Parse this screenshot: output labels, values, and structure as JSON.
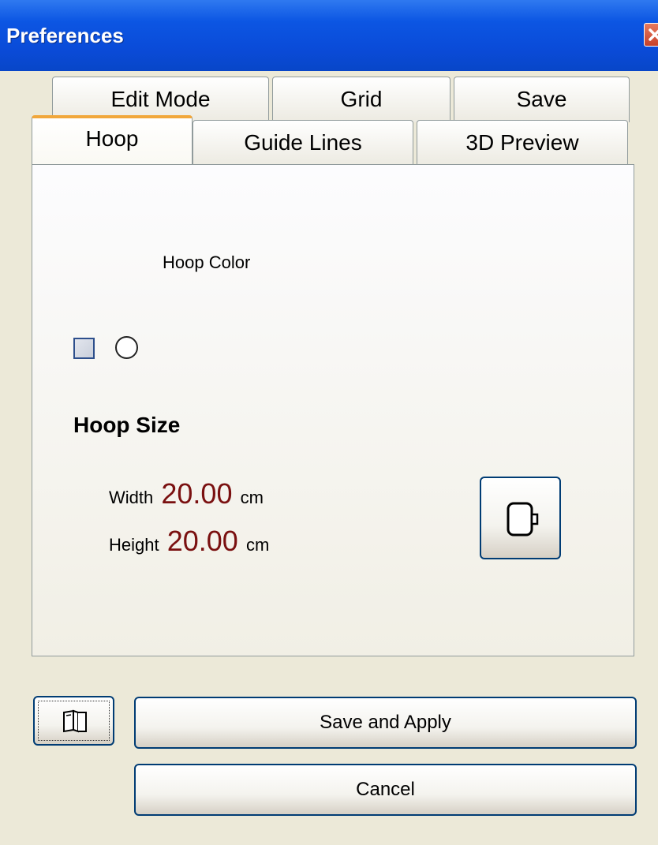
{
  "window": {
    "title": "Preferences"
  },
  "tabs": {
    "row_back": [
      {
        "label": "Edit Mode"
      },
      {
        "label": "Grid"
      },
      {
        "label": "Save"
      }
    ],
    "row_front": [
      {
        "label": "Hoop",
        "active": true
      },
      {
        "label": "Guide Lines"
      },
      {
        "label": "3D Preview"
      }
    ]
  },
  "hoop": {
    "color_label": "Hoop Color",
    "color_value": "#ffffff",
    "shape_options": [
      "square-icon",
      "circle-icon"
    ],
    "size_title": "Hoop Size",
    "width_label": "Width",
    "width_value": "20.00",
    "width_unit": "cm",
    "height_label": "Height",
    "height_value": "20.00",
    "height_unit": "cm",
    "orientation_icon": "hoop-orientation-icon"
  },
  "buttons": {
    "help_icon": "book-icon",
    "save_label": "Save and Apply",
    "cancel_label": "Cancel"
  },
  "colors": {
    "titlebar": "#0a4bd8",
    "tab_highlight": "#f1a73b",
    "value_text": "#7a1010",
    "dialog_bg": "#ece9d8"
  }
}
